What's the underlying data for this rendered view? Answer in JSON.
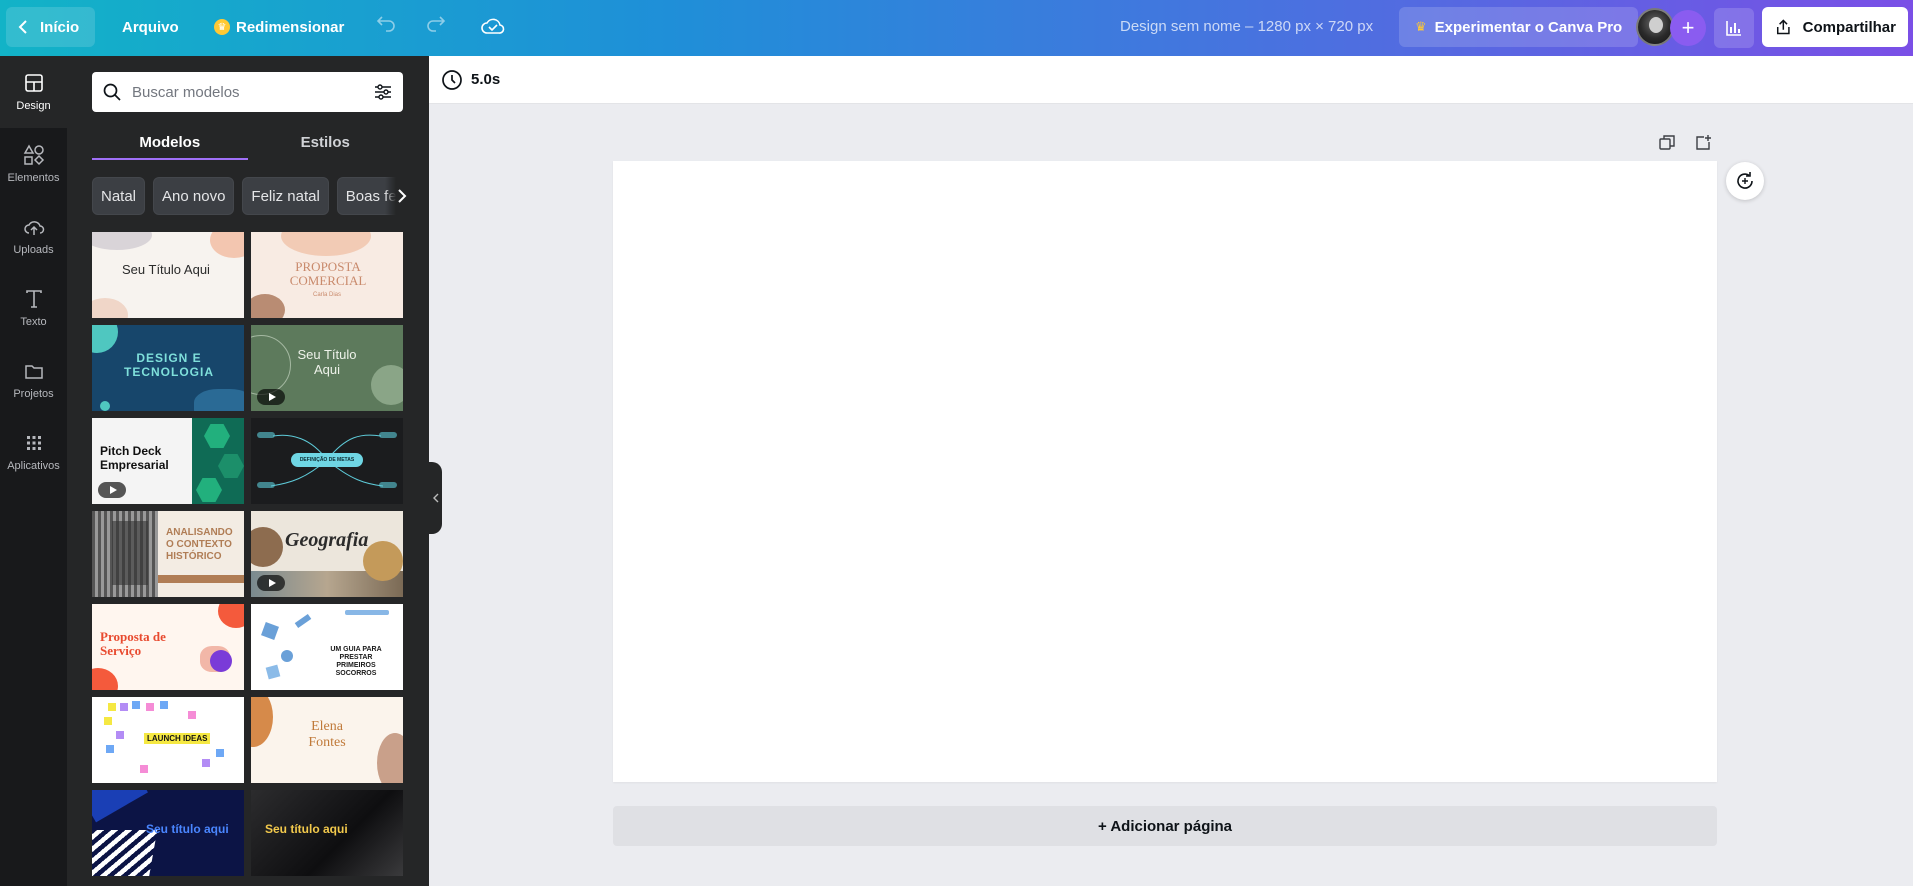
{
  "topbar": {
    "home_label": "Início",
    "file_label": "Arquivo",
    "resize_label": "Redimensionar",
    "design_title": "Design sem nome – 1280 px × 720 px",
    "pro_label": "Experimentar o Canva Pro",
    "share_label": "Compartilhar"
  },
  "rail": {
    "items": [
      {
        "label": "Design",
        "icon": "layout-icon"
      },
      {
        "label": "Elementos",
        "icon": "shapes-icon"
      },
      {
        "label": "Uploads",
        "icon": "cloud-upload-icon"
      },
      {
        "label": "Texto",
        "icon": "text-icon"
      },
      {
        "label": "Projetos",
        "icon": "folder-icon"
      },
      {
        "label": "Aplicativos",
        "icon": "apps-grid-icon"
      }
    ]
  },
  "panel": {
    "search_placeholder": "Buscar modelos",
    "tabs": [
      "Modelos",
      "Estilos"
    ],
    "chips": [
      "Natal",
      "Ano novo",
      "Feliz natal",
      "Boas festas"
    ],
    "templates": [
      {
        "title": "Seu Título Aqui",
        "subtitle": ""
      },
      {
        "title": "PROPOSTA COMERCIAL",
        "subtitle": "Carla Dias"
      },
      {
        "title": "DESIGN E TECNOLOGIA",
        "subtitle": ""
      },
      {
        "title": "Seu Título Aqui",
        "subtitle": ""
      },
      {
        "title": "Pitch Deck Empresarial",
        "subtitle": ""
      },
      {
        "title": "DEFINIÇÃO DE METAS",
        "subtitle": ""
      },
      {
        "title": "ANALISANDO O CONTEXTO HISTÓRICO",
        "subtitle": ""
      },
      {
        "title": "Geografia",
        "subtitle": ""
      },
      {
        "title": "Proposta de Serviço",
        "subtitle": ""
      },
      {
        "title": "UM GUIA PARA PRESTAR PRIMEIROS SOCORROS",
        "subtitle": ""
      },
      {
        "title": "LAUNCH IDEAS",
        "subtitle": ""
      },
      {
        "title": "Elena Fontes",
        "subtitle": ""
      },
      {
        "title": "Seu título aqui",
        "subtitle": ""
      },
      {
        "title": "Seu título aqui",
        "subtitle": ""
      }
    ]
  },
  "editor": {
    "duration": "5.0s",
    "add_page_label": "+ Adicionar página"
  },
  "colors": {
    "accent_purple": "#8b3dff",
    "panel_bg": "#252627",
    "rail_bg": "#18191b"
  }
}
